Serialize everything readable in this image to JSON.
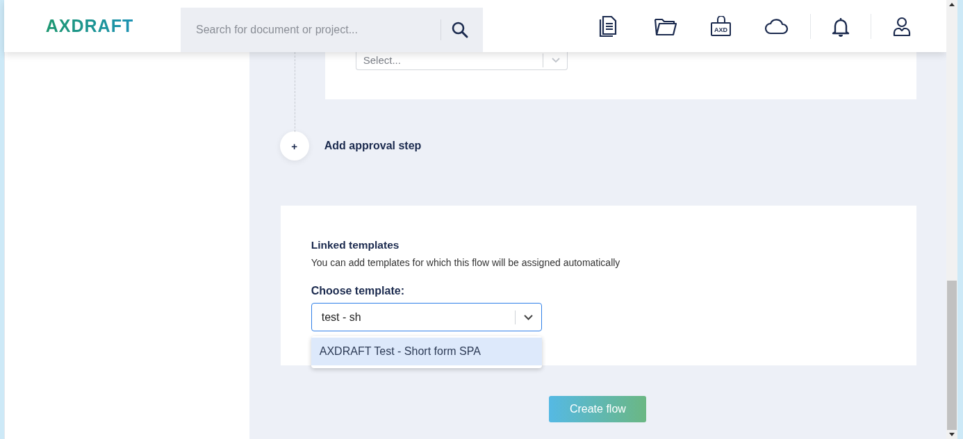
{
  "header": {
    "logo": "AXDRAFT",
    "search": {
      "placeholder": "Search for document or project..."
    },
    "nav_icons": [
      {
        "kind": "documents"
      },
      {
        "kind": "folder"
      },
      {
        "kind": "bag",
        "label": "AXD"
      },
      {
        "kind": "cloud"
      },
      {
        "kind": "bell"
      },
      {
        "kind": "user"
      }
    ]
  },
  "approver_step": {
    "select": {
      "placeholder": "Select..."
    }
  },
  "add_step": {
    "icon": "+",
    "label": "Add approval step"
  },
  "linked_templates": {
    "title": "Linked templates",
    "description": "You can add templates for which this flow will be assigned automatically",
    "field_label": "Choose template:",
    "input": {
      "value": "test - sh"
    },
    "options": [
      {
        "label": "AXDRAFT Test - Short form SPA",
        "selected": true
      }
    ]
  },
  "create_button": "Create flow"
}
